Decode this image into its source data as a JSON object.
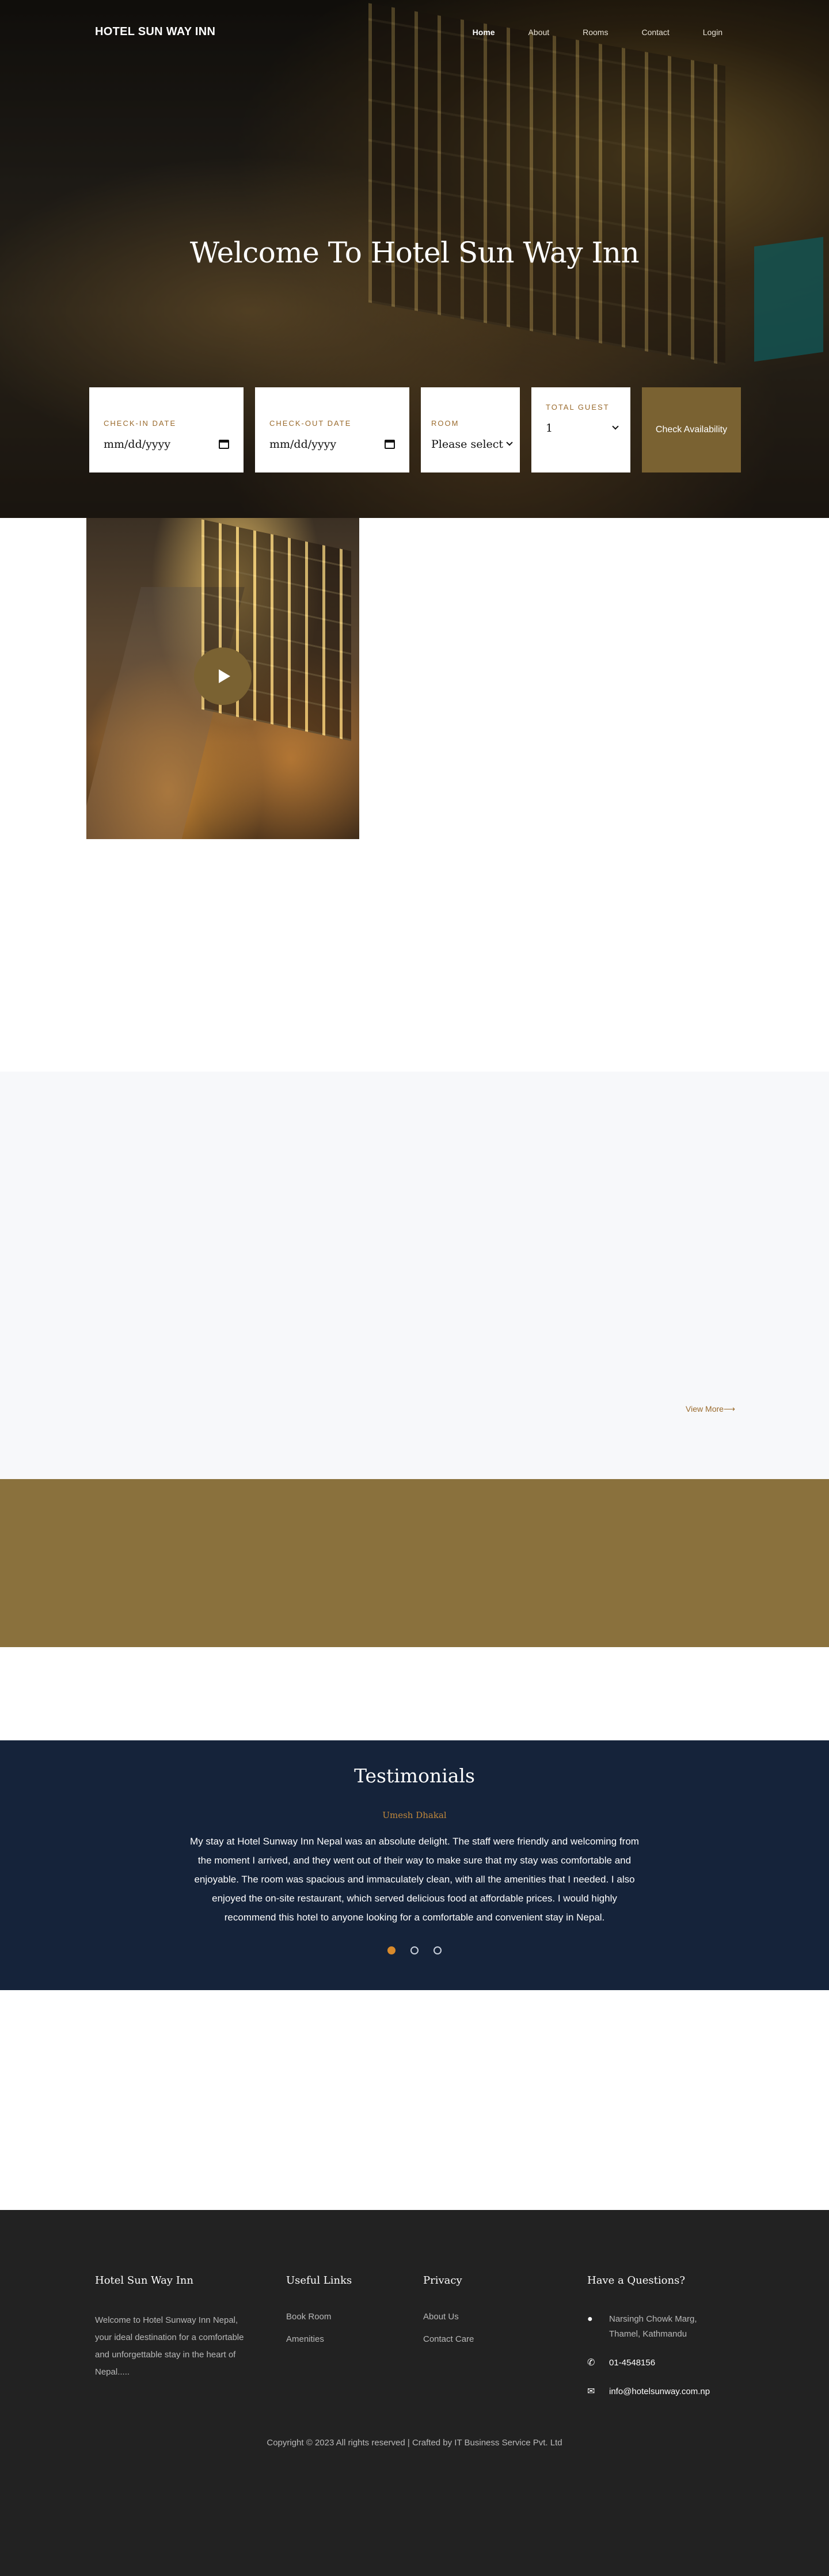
{
  "nav": {
    "brand": "HOTEL SUN WAY INN",
    "links": [
      {
        "label": "Home",
        "active": true
      },
      {
        "label": "About",
        "active": false
      },
      {
        "label": "Rooms",
        "active": false
      },
      {
        "label": "Contact",
        "active": false
      },
      {
        "label": "Login",
        "active": false
      }
    ]
  },
  "hero": {
    "title": "Welcome To Hotel Sun Way Inn"
  },
  "booking": {
    "checkin_label": "CHECK-IN DATE",
    "checkin_value": "mm/dd/yyyy",
    "checkout_label": "CHECK-OUT DATE",
    "checkout_value": "mm/dd/yyyy",
    "room_label": "ROOM",
    "room_value": "Please select",
    "guest_label": "TOTAL GUEST",
    "guest_value": "1",
    "button_label": "Check Availability"
  },
  "rooms": {
    "view_more": "View More⟶"
  },
  "testimonials": {
    "title": "Testimonials",
    "name": "Umesh Dhakal",
    "text": "My stay at Hotel Sunway Inn Nepal was an absolute delight. The staff were friendly and welcoming from the moment I arrived, and they went out of their way to make sure that my stay was comfortable and enjoyable. The room was spacious and immaculately clean, with all the amenities that I needed. I also enjoyed the on-site restaurant, which served delicious food at affordable prices. I would highly recommend this hotel to anyone looking for a comfortable and convenient stay in Nepal.",
    "dots_active_index": 0
  },
  "footer": {
    "about_title": "Hotel Sun Way Inn",
    "about_text": "Welcome to Hotel Sunway Inn Nepal, your ideal destination for a comfortable and unforgettable stay in the heart of Nepal.....",
    "links_title": "Useful Links",
    "links": [
      "Book Room",
      "Amenities"
    ],
    "privacy_title": "Privacy",
    "privacy_links": [
      "About Us",
      "Contact Care"
    ],
    "contact_title": "Have a Questions?",
    "address": "Narsingh Chowk Marg, Thamel, Kathmandu",
    "phone": "01-4548156",
    "email": "info@hotelsunway.com.np",
    "copyright": "Copyright © 2023 All rights reserved | Crafted by IT Business Service Pvt. Ltd"
  },
  "colors": {
    "accent_gold": "#7a6232",
    "band_gold": "#8a713d",
    "label_brown": "#9a6a2c",
    "testimonial_bg": "#15233a",
    "footer_bg": "#222222",
    "dot_active": "#d98a2b"
  },
  "icons": [
    "calendar-icon",
    "chevron-down-icon",
    "play-icon",
    "map-pin-icon",
    "phone-icon",
    "envelope-icon"
  ]
}
